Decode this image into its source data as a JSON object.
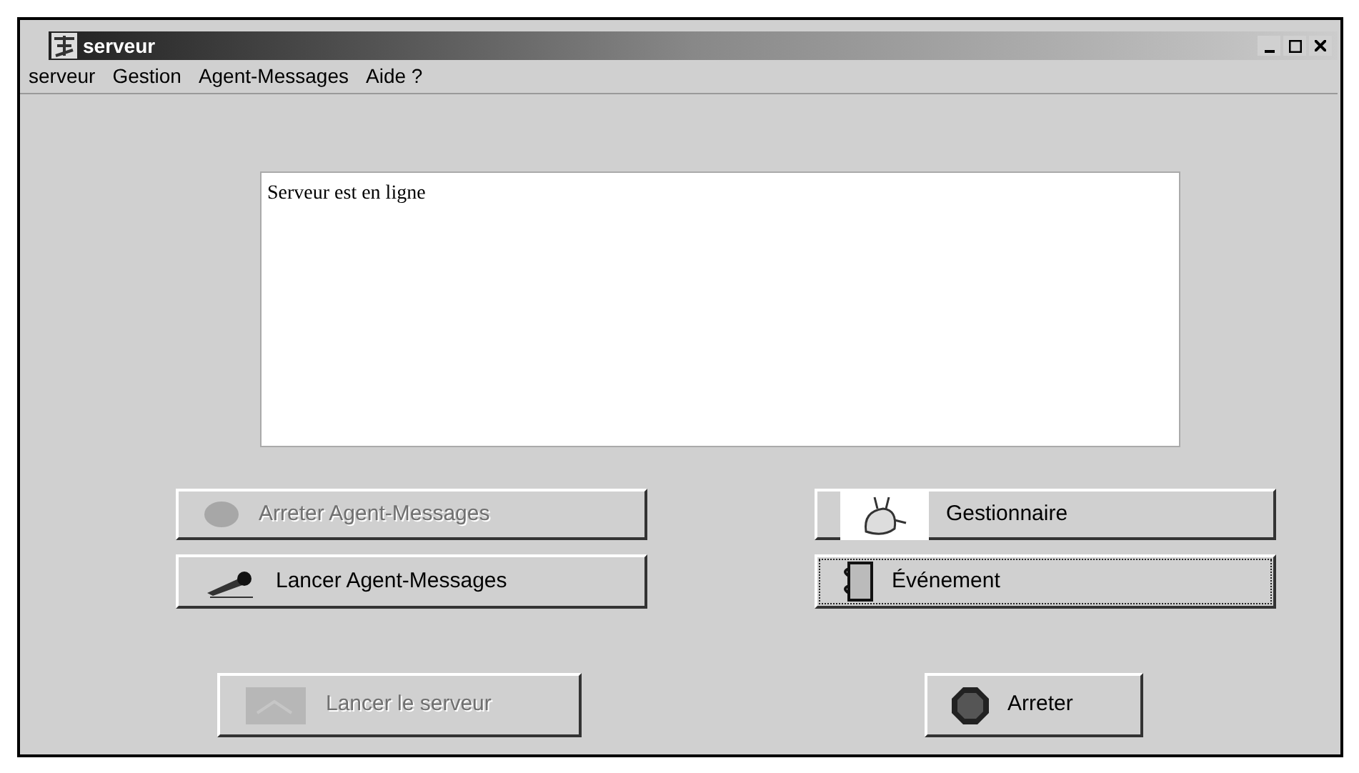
{
  "window": {
    "title": "serveur"
  },
  "menu": [
    "serveur",
    "Gestion",
    "Agent-Messages",
    "Aide ?"
  ],
  "log": {
    "text": "Serveur est en ligne"
  },
  "buttons": [
    {
      "label": "Arreter Agent-Messages",
      "kind": "blob",
      "disabled": true,
      "focused": false
    },
    {
      "label": "Gestionnaire",
      "kind": "figure",
      "disabled": false,
      "focused": false
    },
    {
      "label": "Lancer Agent-Messages",
      "kind": "pen",
      "disabled": false,
      "focused": false
    },
    {
      "label": "Événement",
      "kind": "notebook",
      "disabled": false,
      "focused": true
    },
    {
      "label": "Lancer le serveur",
      "kind": "square",
      "disabled": true,
      "focused": false
    },
    {
      "label": "Arreter",
      "kind": "stop",
      "disabled": false,
      "focused": false
    }
  ]
}
